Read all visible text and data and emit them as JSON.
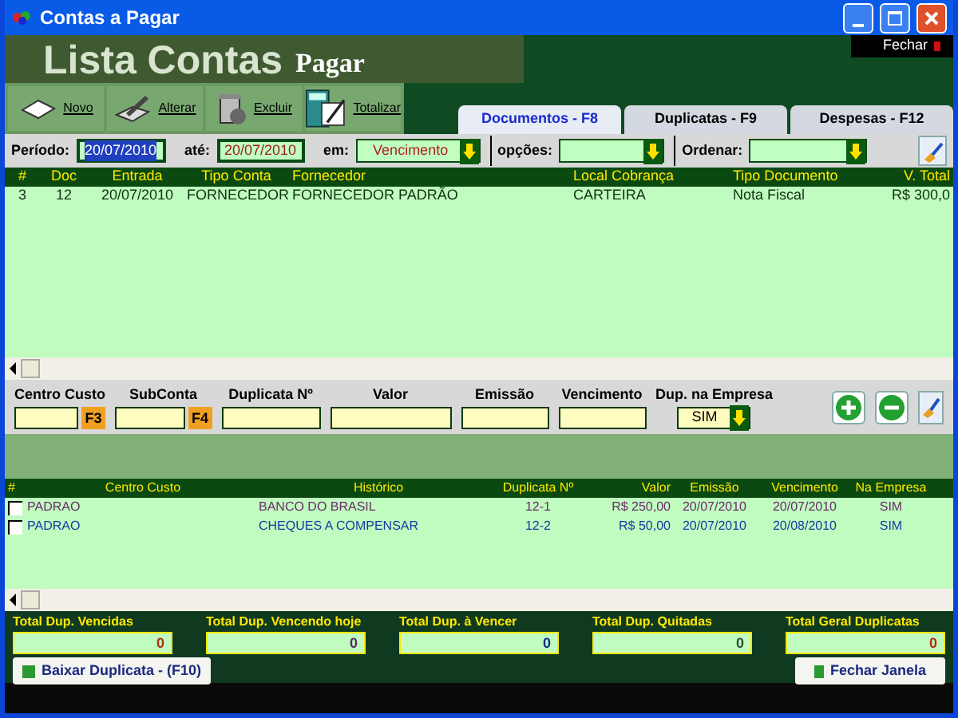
{
  "window": {
    "title": "Contas a Pagar"
  },
  "banner": {
    "title": "Lista Contas",
    "subtitle": "Pagar",
    "close_label": "Fechar"
  },
  "toolbar": [
    {
      "label": "Novo",
      "kind": "doc"
    },
    {
      "label": "Alterar",
      "kind": "pen"
    },
    {
      "label": "Excluir",
      "kind": "trash"
    },
    {
      "label": "Totalizar",
      "kind": "calc"
    }
  ],
  "tabs": [
    {
      "label": "Documentos - F8",
      "selected": true
    },
    {
      "label": "Duplicatas - F9",
      "selected": false
    },
    {
      "label": "Despesas - F12",
      "selected": false
    }
  ],
  "filters": {
    "periodo_label": "Período:",
    "periodo_from": "20/07/2010",
    "ate_label": "até:",
    "periodo_to": "20/07/2010",
    "em_label": "em:",
    "em_value": "Vencimento",
    "opcoes_label": "opções:",
    "ordenar_label": "Ordenar:"
  },
  "documents": {
    "columns": [
      "#",
      "Doc",
      "Entrada",
      "Tipo Conta",
      "Fornecedor",
      "Local Cobrança",
      "Tipo Documento",
      "V. Total"
    ],
    "rows": [
      [
        "3",
        "12",
        "20/07/2010",
        "FORNECEDOR",
        "FORNECEDOR PADRÃO",
        "CARTEIRA",
        "Nota Fiscal",
        "R$ 300,0"
      ]
    ]
  },
  "entry_form": {
    "fields": [
      {
        "label": "Centro Custo",
        "key_hint": "F3"
      },
      {
        "label": "SubConta",
        "key_hint": "F4"
      },
      {
        "label": "Duplicata Nº"
      },
      {
        "label": "Valor"
      },
      {
        "label": "Emissão"
      },
      {
        "label": "Vencimento"
      }
    ],
    "empresa_label": "Dup. na Empresa",
    "empresa_value": "SIM"
  },
  "duplicates": {
    "checkbox_header": "#",
    "columns": [
      "Centro Custo",
      "Histórico",
      "Duplicata Nº",
      "Valor",
      "Emissão",
      "Vencimento",
      "Na Empresa"
    ],
    "rows": [
      {
        "checked": false,
        "color": "#6b2a6b",
        "cells": [
          "PADRAO",
          "BANCO DO BRASIL",
          "12-1",
          "R$ 250,00",
          "20/07/2010",
          "20/07/2010",
          "SIM"
        ]
      },
      {
        "checked": false,
        "color": "#1a3aa0",
        "cells": [
          "PADRAO",
          "CHEQUES A COMPENSAR",
          "12-2",
          "R$ 50,00",
          "20/07/2010",
          "20/08/2010",
          "SIM"
        ]
      }
    ]
  },
  "totals": [
    {
      "label": "Total Dup. Vencidas",
      "value": "0",
      "color": "#b03010"
    },
    {
      "label": "Total Dup. Vencendo hoje",
      "value": "0",
      "color": "#5a2a6a"
    },
    {
      "label": "Total Dup. à Vencer",
      "value": "0",
      "color": "#10308a"
    },
    {
      "label": "Total Dup. Quitadas",
      "value": "0",
      "color": "#305030"
    },
    {
      "label": "Total Geral Duplicatas",
      "value": "0",
      "color": "#b03010"
    }
  ],
  "buttons": {
    "baixar": "Baixar Duplicata - (F10)",
    "fechar": "Fechar Janela"
  }
}
